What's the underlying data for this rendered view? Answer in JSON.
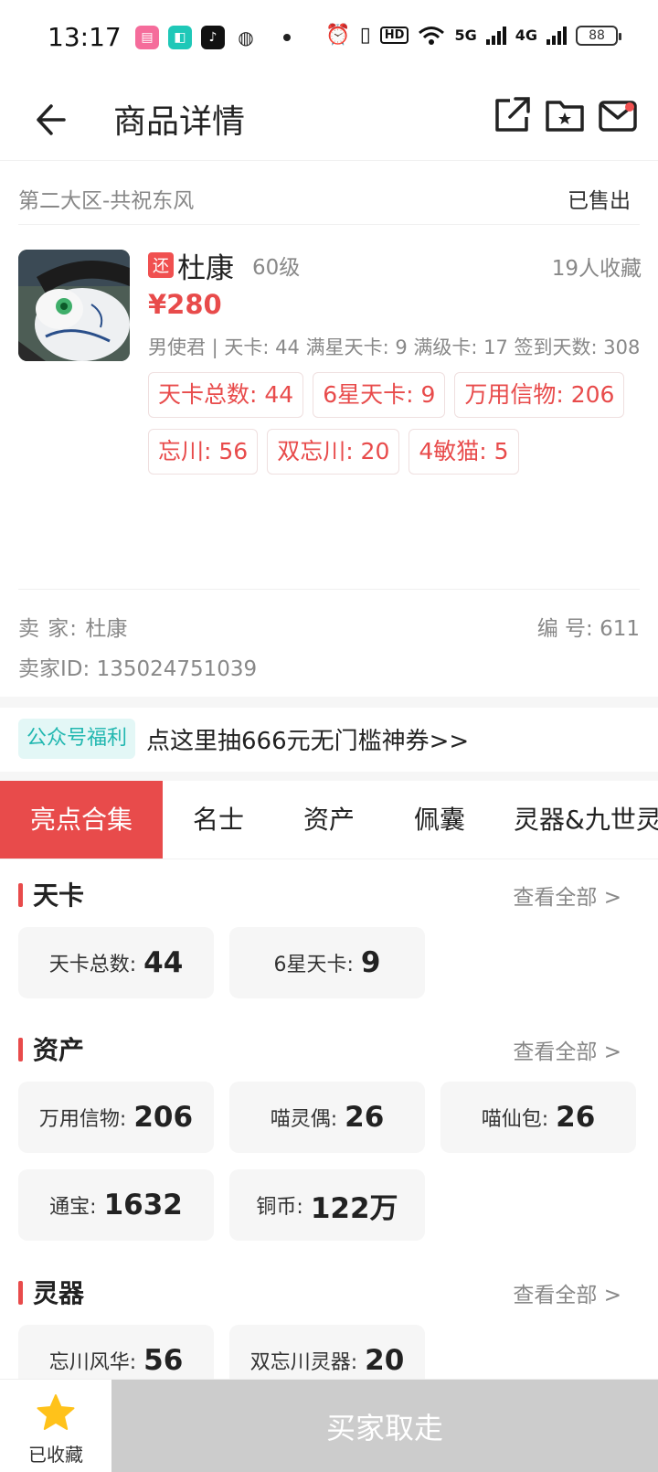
{
  "status_bar": {
    "time": "13:17",
    "battery": "88",
    "hd_label": "HD",
    "net1": "5G",
    "net2": "4G"
  },
  "header": {
    "title": "商品详情"
  },
  "listing": {
    "server": "第二大区-共祝东风",
    "status": "已售出",
    "return_badge": "还",
    "name": "杜康",
    "level": "60级",
    "favorites": "19人收藏",
    "price": "¥280",
    "summary": "男使君 | 天卡: 44 满星天卡: 9 满级卡: 17 签到天数: 308",
    "tags": [
      "天卡总数: 44",
      "6星天卡: 9",
      "万用信物: 206",
      "忘川: 56",
      "双忘川: 20",
      "4敏猫: 5"
    ],
    "seller_label": "卖 家: ",
    "seller_name": "杜康",
    "serial_label": "编 号: ",
    "serial": "611",
    "seller_id_label": "卖家ID: ",
    "seller_id": "135024751039"
  },
  "promo": {
    "tag": "公众号福利",
    "text": "点这里抽666元无门槛神券>>"
  },
  "tabs": [
    "亮点合集",
    "名士",
    "资产",
    "佩囊",
    "灵器&九世灵"
  ],
  "sections": {
    "tianka": {
      "title": "天卡",
      "more": "查看全部 >",
      "cards": [
        {
          "label": "天卡总数:",
          "value": "44"
        },
        {
          "label": "6星天卡:",
          "value": "9"
        }
      ]
    },
    "assets": {
      "title": "资产",
      "more": "查看全部 >",
      "cards": [
        {
          "label": "万用信物:",
          "value": "206"
        },
        {
          "label": "喵灵偶:",
          "value": "26"
        },
        {
          "label": "喵仙包:",
          "value": "26"
        },
        {
          "label": "通宝:",
          "value": "1632"
        },
        {
          "label": "铜币:",
          "value": "122万"
        }
      ]
    },
    "lingqi": {
      "title": "灵器",
      "more": "查看全部 >",
      "cards": [
        {
          "label": "忘川风华:",
          "value": "56"
        },
        {
          "label": "双忘川灵器:",
          "value": "20"
        }
      ]
    }
  },
  "bottom_bar": {
    "fav_label": "已收藏",
    "buy_label": "买家取走"
  },
  "colors": {
    "accent": "#e84b4b",
    "promo": "#21b7b0",
    "star": "#ffc21a",
    "disabled": "#cccccc"
  }
}
